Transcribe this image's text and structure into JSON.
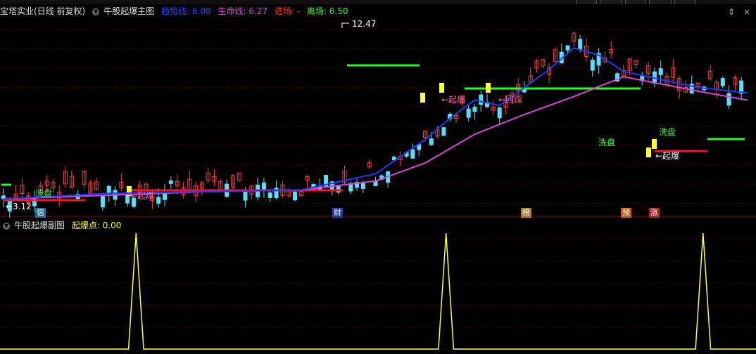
{
  "main": {
    "stock_name": "宝塔实业(日线 前复权)",
    "indicator": "牛股起爆主图",
    "trend_label": "趋势线",
    "trend_value": "6.08",
    "life_label": "生命线",
    "life_value": "6.27",
    "entry_label": "进场",
    "entry_value": "-",
    "exit_label": "离场",
    "exit_value": "6.50",
    "high_label": "12.47",
    "low_label": "3.12",
    "annotations": {
      "xipan1": "洗盘",
      "qibao1": "←起爆",
      "qibao2": "←起爆",
      "huicai": "←回踩",
      "xipan2": "洗盘",
      "xipan3": "洗盘",
      "qibao3": "←起爆"
    },
    "events": [
      "信",
      "财",
      "榜",
      "预",
      "涨"
    ]
  },
  "sub": {
    "indicator": "牛股起爆副图",
    "point_label": "起爆点",
    "point_value": "0.00"
  },
  "colors": {
    "up": "#ff3b3b",
    "down": "#55e0ff",
    "trend": "#1a3cff",
    "life": "#e040e0",
    "entry_line": "#ff1020",
    "exit_line": "#20ff20",
    "signal": "#ffff33",
    "grid": "#550000"
  },
  "icons": [
    "up-down-arrows-icon",
    "close-icon"
  ],
  "chart_data": [
    {
      "type": "line",
      "title": "牛股起爆主图",
      "series": [
        {
          "name": "趋势线",
          "x": [
            0,
            8,
            16,
            24,
            30,
            34,
            36,
            38,
            40,
            44,
            46,
            48,
            50,
            56,
            60
          ],
          "y": [
            3.3,
            3.6,
            3.7,
            3.8,
            4.7,
            6.6,
            7.8,
            8.8,
            8.5,
            10.5,
            11.7,
            11.3,
            10.4,
            9.5,
            9.2
          ]
        },
        {
          "name": "生命线",
          "x": [
            0,
            8,
            16,
            24,
            30,
            34,
            38,
            42,
            46,
            50,
            56,
            60
          ],
          "y": [
            3.3,
            3.5,
            3.7,
            3.8,
            4.3,
            5.3,
            6.9,
            8.0,
            9.0,
            10.1,
            9.3,
            8.8
          ]
        }
      ],
      "ylim": [
        3,
        13
      ]
    },
    {
      "type": "line",
      "title": "牛股起爆副图",
      "series": [
        {
          "name": "起爆点",
          "x": [
            0,
            17,
            18,
            19,
            58,
            59,
            60,
            92,
            93,
            94,
            100
          ],
          "y": [
            0,
            0,
            1,
            0,
            0,
            1,
            0,
            0,
            1,
            0,
            0
          ]
        }
      ],
      "ylim": [
        0,
        1
      ]
    }
  ]
}
